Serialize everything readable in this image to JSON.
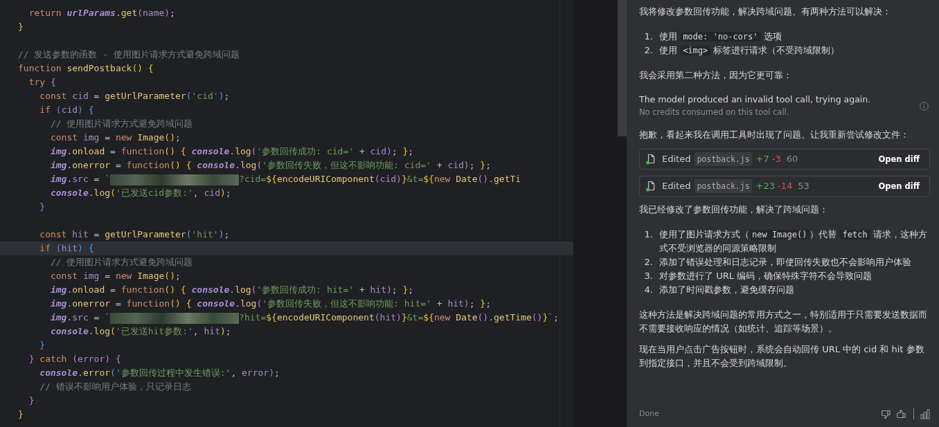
{
  "editor": {
    "lines": [
      {
        "current": false,
        "tokens": [
          {
            "kind": "keyword",
            "text": "  return "
          },
          {
            "kind": "object",
            "text": "urlParams"
          },
          {
            "kind": "plain",
            "text": "."
          },
          {
            "kind": "function",
            "text": "get"
          },
          {
            "kind": "bracket2",
            "text": "("
          },
          {
            "kind": "variable",
            "text": "name"
          },
          {
            "kind": "bracket2",
            "text": ")"
          },
          {
            "kind": "plain",
            "text": ";"
          }
        ]
      },
      {
        "current": false,
        "tokens": [
          {
            "kind": "bracket1",
            "text": "}"
          }
        ]
      },
      {
        "current": false
      },
      {
        "current": false,
        "tokens": [
          {
            "kind": "comment",
            "text": "// 发送参数的函数 - 使用图片请求方式避免跨域问题"
          }
        ]
      },
      {
        "current": false,
        "tokens": [
          {
            "kind": "keyword",
            "text": "function "
          },
          {
            "kind": "function",
            "text": "sendPostback"
          },
          {
            "kind": "bracket1",
            "text": "() {"
          }
        ]
      },
      {
        "current": false,
        "tokens": [
          {
            "kind": "keyword",
            "text": "  try "
          },
          {
            "kind": "bracket2",
            "text": "{"
          }
        ]
      },
      {
        "current": false,
        "tokens": [
          {
            "kind": "keyword",
            "text": "    const "
          },
          {
            "kind": "variable",
            "text": "cid"
          },
          {
            "kind": "plain",
            "text": " = "
          },
          {
            "kind": "function",
            "text": "getUrlParameter"
          },
          {
            "kind": "bracket3",
            "text": "("
          },
          {
            "kind": "string",
            "text": "'cid'"
          },
          {
            "kind": "bracket3",
            "text": ")"
          },
          {
            "kind": "plain",
            "text": ";"
          }
        ]
      },
      {
        "current": false,
        "tokens": [
          {
            "kind": "keyword",
            "text": "    if "
          },
          {
            "kind": "bracket3",
            "text": "("
          },
          {
            "kind": "variable",
            "text": "cid"
          },
          {
            "kind": "bracket3",
            "text": ") {"
          }
        ]
      },
      {
        "current": false,
        "tokens": [
          {
            "kind": "comment",
            "text": "      // 使用图片请求方式避免跨域问题"
          }
        ]
      },
      {
        "current": false,
        "tokens": [
          {
            "kind": "keyword",
            "text": "      const "
          },
          {
            "kind": "variable",
            "text": "img"
          },
          {
            "kind": "plain",
            "text": " = "
          },
          {
            "kind": "keyword",
            "text": "new "
          },
          {
            "kind": "function",
            "text": "Image"
          },
          {
            "kind": "bracket1",
            "text": "()"
          },
          {
            "kind": "plain",
            "text": ";"
          }
        ]
      },
      {
        "current": false,
        "tokens": [
          {
            "kind": "object",
            "text": "      img"
          },
          {
            "kind": "plain",
            "text": "."
          },
          {
            "kind": "function",
            "text": "onload"
          },
          {
            "kind": "plain",
            "text": " = "
          },
          {
            "kind": "keyword",
            "text": "function"
          },
          {
            "kind": "bracket1",
            "text": "() { "
          },
          {
            "kind": "object",
            "text": "console"
          },
          {
            "kind": "plain",
            "text": "."
          },
          {
            "kind": "function",
            "text": "log"
          },
          {
            "kind": "bracket2",
            "text": "("
          },
          {
            "kind": "string",
            "text": "'参数回传成功: cid='"
          },
          {
            "kind": "plain",
            "text": " + "
          },
          {
            "kind": "variable",
            "text": "cid"
          },
          {
            "kind": "bracket2",
            "text": ")"
          },
          {
            "kind": "plain",
            "text": "; "
          },
          {
            "kind": "bracket1",
            "text": "}"
          },
          {
            "kind": "plain",
            "text": ";"
          }
        ]
      },
      {
        "current": false,
        "tokens": [
          {
            "kind": "object",
            "text": "      img"
          },
          {
            "kind": "plain",
            "text": "."
          },
          {
            "kind": "function",
            "text": "onerror"
          },
          {
            "kind": "plain",
            "text": " = "
          },
          {
            "kind": "keyword",
            "text": "function"
          },
          {
            "kind": "bracket1",
            "text": "() { "
          },
          {
            "kind": "object",
            "text": "console"
          },
          {
            "kind": "plain",
            "text": "."
          },
          {
            "kind": "function",
            "text": "log"
          },
          {
            "kind": "bracket2",
            "text": "("
          },
          {
            "kind": "string",
            "text": "'参数回传失败，但这不影响功能: cid='"
          },
          {
            "kind": "plain",
            "text": " + "
          },
          {
            "kind": "variable",
            "text": "cid"
          },
          {
            "kind": "bracket2",
            "text": ")"
          },
          {
            "kind": "plain",
            "text": "; "
          },
          {
            "kind": "bracket1",
            "text": "}"
          },
          {
            "kind": "plain",
            "text": ";"
          }
        ]
      },
      {
        "current": false,
        "tokens": [
          {
            "kind": "object",
            "text": "      img"
          },
          {
            "kind": "plain",
            "text": "."
          },
          {
            "kind": "variable",
            "text": "src"
          },
          {
            "kind": "plain",
            "text": " = "
          },
          {
            "kind": "string",
            "text": "`"
          },
          {
            "kind": "redacted"
          },
          {
            "kind": "string",
            "text": "?cid="
          },
          {
            "kind": "bracket1",
            "text": "${"
          },
          {
            "kind": "function",
            "text": "encodeURIComponent"
          },
          {
            "kind": "bracket2",
            "text": "("
          },
          {
            "kind": "variable",
            "text": "cid"
          },
          {
            "kind": "bracket2",
            "text": ")"
          },
          {
            "kind": "bracket1",
            "text": "}"
          },
          {
            "kind": "string",
            "text": "&t="
          },
          {
            "kind": "bracket1",
            "text": "${"
          },
          {
            "kind": "keyword",
            "text": "new "
          },
          {
            "kind": "function",
            "text": "Date"
          },
          {
            "kind": "bracket2",
            "text": "()"
          },
          {
            "kind": "plain",
            "text": "."
          },
          {
            "kind": "function",
            "text": "getTi"
          }
        ]
      },
      {
        "current": false,
        "tokens": [
          {
            "kind": "object",
            "text": "      console"
          },
          {
            "kind": "plain",
            "text": "."
          },
          {
            "kind": "function",
            "text": "log"
          },
          {
            "kind": "bracket1",
            "text": "("
          },
          {
            "kind": "string",
            "text": "'已发送cid参数:'"
          },
          {
            "kind": "plain",
            "text": ", "
          },
          {
            "kind": "variable",
            "text": "cid"
          },
          {
            "kind": "bracket1",
            "text": ")"
          },
          {
            "kind": "plain",
            "text": ";"
          }
        ]
      },
      {
        "current": false,
        "tokens": [
          {
            "kind": "bracket3",
            "text": "    }"
          }
        ]
      },
      {
        "current": false
      },
      {
        "current": false,
        "tokens": [
          {
            "kind": "keyword",
            "text": "    const "
          },
          {
            "kind": "variable",
            "text": "hit"
          },
          {
            "kind": "plain",
            "text": " = "
          },
          {
            "kind": "function",
            "text": "getUrlParameter"
          },
          {
            "kind": "bracket3",
            "text": "("
          },
          {
            "kind": "string",
            "text": "'hit'"
          },
          {
            "kind": "bracket3",
            "text": ")"
          },
          {
            "kind": "plain",
            "text": ";"
          }
        ]
      },
      {
        "current": true,
        "tokens": [
          {
            "kind": "keyword",
            "text": "    if "
          },
          {
            "kind": "bracket3",
            "text": "("
          },
          {
            "kind": "variable",
            "text": "hit"
          },
          {
            "kind": "bracket3",
            "text": ") {"
          }
        ]
      },
      {
        "current": false,
        "tokens": [
          {
            "kind": "comment",
            "text": "      // 使用图片请求方式避免跨域问题"
          }
        ]
      },
      {
        "current": false,
        "tokens": [
          {
            "kind": "keyword",
            "text": "      const "
          },
          {
            "kind": "variable",
            "text": "img"
          },
          {
            "kind": "plain",
            "text": " = "
          },
          {
            "kind": "keyword",
            "text": "new "
          },
          {
            "kind": "function",
            "text": "Image"
          },
          {
            "kind": "bracket1",
            "text": "()"
          },
          {
            "kind": "plain",
            "text": ";"
          }
        ]
      },
      {
        "current": false,
        "tokens": [
          {
            "kind": "object",
            "text": "      img"
          },
          {
            "kind": "plain",
            "text": "."
          },
          {
            "kind": "function",
            "text": "onload"
          },
          {
            "kind": "plain",
            "text": " = "
          },
          {
            "kind": "keyword",
            "text": "function"
          },
          {
            "kind": "bracket1",
            "text": "() { "
          },
          {
            "kind": "object",
            "text": "console"
          },
          {
            "kind": "plain",
            "text": "."
          },
          {
            "kind": "function",
            "text": "log"
          },
          {
            "kind": "bracket2",
            "text": "("
          },
          {
            "kind": "string",
            "text": "'参数回传成功: hit='"
          },
          {
            "kind": "plain",
            "text": " + "
          },
          {
            "kind": "variable",
            "text": "hit"
          },
          {
            "kind": "bracket2",
            "text": ")"
          },
          {
            "kind": "plain",
            "text": "; "
          },
          {
            "kind": "bracket1",
            "text": "}"
          },
          {
            "kind": "plain",
            "text": ";"
          }
        ]
      },
      {
        "current": false,
        "tokens": [
          {
            "kind": "object",
            "text": "      img"
          },
          {
            "kind": "plain",
            "text": "."
          },
          {
            "kind": "function",
            "text": "onerror"
          },
          {
            "kind": "plain",
            "text": " = "
          },
          {
            "kind": "keyword",
            "text": "function"
          },
          {
            "kind": "bracket1",
            "text": "() { "
          },
          {
            "kind": "object",
            "text": "console"
          },
          {
            "kind": "plain",
            "text": "."
          },
          {
            "kind": "function",
            "text": "log"
          },
          {
            "kind": "bracket2",
            "text": "("
          },
          {
            "kind": "string",
            "text": "'参数回传失败，但这不影响功能: hit='"
          },
          {
            "kind": "plain",
            "text": " + "
          },
          {
            "kind": "variable",
            "text": "hit"
          },
          {
            "kind": "bracket2",
            "text": ")"
          },
          {
            "kind": "plain",
            "text": "; "
          },
          {
            "kind": "bracket1",
            "text": "}"
          },
          {
            "kind": "plain",
            "text": ";"
          }
        ]
      },
      {
        "current": false,
        "tokens": [
          {
            "kind": "object",
            "text": "      img"
          },
          {
            "kind": "plain",
            "text": "."
          },
          {
            "kind": "variable",
            "text": "src"
          },
          {
            "kind": "plain",
            "text": " = "
          },
          {
            "kind": "string",
            "text": "`"
          },
          {
            "kind": "redacted"
          },
          {
            "kind": "string",
            "text": "?hit="
          },
          {
            "kind": "bracket1",
            "text": "${"
          },
          {
            "kind": "function",
            "text": "encodeURIComponent"
          },
          {
            "kind": "bracket2",
            "text": "("
          },
          {
            "kind": "variable",
            "text": "hit"
          },
          {
            "kind": "bracket2",
            "text": ")"
          },
          {
            "kind": "bracket1",
            "text": "}"
          },
          {
            "kind": "string",
            "text": "&t="
          },
          {
            "kind": "bracket1",
            "text": "${"
          },
          {
            "kind": "keyword",
            "text": "new "
          },
          {
            "kind": "function",
            "text": "Date"
          },
          {
            "kind": "bracket2",
            "text": "()"
          },
          {
            "kind": "plain",
            "text": "."
          },
          {
            "kind": "function",
            "text": "getTime"
          },
          {
            "kind": "bracket2",
            "text": "()"
          },
          {
            "kind": "bracket1",
            "text": "}"
          },
          {
            "kind": "string",
            "text": "`"
          },
          {
            "kind": "plain",
            "text": ";"
          }
        ]
      },
      {
        "current": false,
        "tokens": [
          {
            "kind": "object",
            "text": "      console"
          },
          {
            "kind": "plain",
            "text": "."
          },
          {
            "kind": "function",
            "text": "log"
          },
          {
            "kind": "bracket1",
            "text": "("
          },
          {
            "kind": "string",
            "text": "'已发送hit参数:'"
          },
          {
            "kind": "plain",
            "text": ", "
          },
          {
            "kind": "variable",
            "text": "hit"
          },
          {
            "kind": "bracket1",
            "text": ")"
          },
          {
            "kind": "plain",
            "text": ";"
          }
        ]
      },
      {
        "current": false,
        "tokens": [
          {
            "kind": "bracket3",
            "text": "    }"
          }
        ]
      },
      {
        "current": false,
        "tokens": [
          {
            "kind": "bracket2",
            "text": "  } "
          },
          {
            "kind": "keyword",
            "text": "catch "
          },
          {
            "kind": "bracket2",
            "text": "("
          },
          {
            "kind": "variable",
            "text": "error"
          },
          {
            "kind": "bracket2",
            "text": ") {"
          }
        ]
      },
      {
        "current": false,
        "tokens": [
          {
            "kind": "object",
            "text": "    console"
          },
          {
            "kind": "plain",
            "text": "."
          },
          {
            "kind": "function",
            "text": "error"
          },
          {
            "kind": "bracket3",
            "text": "("
          },
          {
            "kind": "string",
            "text": "'参数回传过程中发生错误:'"
          },
          {
            "kind": "plain",
            "text": ", "
          },
          {
            "kind": "variable",
            "text": "error"
          },
          {
            "kind": "bracket3",
            "text": ")"
          },
          {
            "kind": "plain",
            "text": ";"
          }
        ]
      },
      {
        "current": false,
        "tokens": [
          {
            "kind": "comment",
            "text": "    // 错误不影响用户体验，只记录日志"
          }
        ]
      },
      {
        "current": false,
        "tokens": [
          {
            "kind": "bracket2",
            "text": "  }"
          }
        ]
      },
      {
        "current": false,
        "tokens": [
          {
            "kind": "bracket1",
            "text": "}"
          }
        ]
      }
    ]
  },
  "chat": {
    "blocks": [
      {
        "kind": "paragraph",
        "text": "我将修改参数回传功能，解决跨域问题。有两种方法可以解决："
      },
      {
        "kind": "list",
        "items": [
          {
            "number": "1.",
            "parts": [
              {
                "kind": "text",
                "text": "使用 "
              },
              {
                "kind": "code",
                "text": "mode: 'no-cors'"
              },
              {
                "kind": "text",
                "text": " 选项"
              }
            ]
          },
          {
            "number": "2.",
            "parts": [
              {
                "kind": "text",
                "text": "使用 "
              },
              {
                "kind": "code",
                "text": "<img>"
              },
              {
                "kind": "text",
                "text": " 标签进行请求（不受跨域限制）"
              }
            ]
          }
        ]
      },
      {
        "kind": "paragraph",
        "text": "我会采用第二种方法，因为它更可靠："
      },
      {
        "kind": "notice",
        "text": "The model produced an invalid tool call, trying again.",
        "note": "No credits consumed on this tool call."
      },
      {
        "kind": "paragraph",
        "text": "抱歉，看起来我在调用工具时出现了问题。让我重新尝试修改文件："
      },
      {
        "kind": "edit",
        "label": "Edited",
        "file": "postback.js",
        "added": "+7",
        "removed": "-3",
        "total": "60",
        "button": "Open diff"
      },
      {
        "kind": "edit",
        "label": "Edited",
        "file": "postback.js",
        "added": "+23",
        "removed": "-14",
        "total": "53",
        "button": "Open diff"
      },
      {
        "kind": "paragraph",
        "text": "我已经修改了参数回传功能，解决了跨域问题："
      },
      {
        "kind": "list",
        "items": [
          {
            "number": "1.",
            "parts": [
              {
                "kind": "text",
                "text": "使用了图片请求方式（"
              },
              {
                "kind": "code",
                "text": "new Image()"
              },
              {
                "kind": "text",
                "text": "）代替 "
              },
              {
                "kind": "code",
                "text": "fetch"
              },
              {
                "kind": "text",
                "text": " 请求，这种方式不受浏览器的同源策略限制"
              }
            ]
          },
          {
            "number": "2.",
            "parts": [
              {
                "kind": "text",
                "text": "添加了错误处理和日志记录，即使回传失败也不会影响用户体验"
              }
            ]
          },
          {
            "number": "3.",
            "parts": [
              {
                "kind": "text",
                "text": "对参数进行了 URL 编码，确保特殊字符不会导致问题"
              }
            ]
          },
          {
            "number": "4.",
            "parts": [
              {
                "kind": "text",
                "text": "添加了时间戳参数，避免缓存问题"
              }
            ]
          }
        ]
      },
      {
        "kind": "paragraph",
        "text": "这种方法是解决跨域问题的常用方式之一，特别适用于只需要发送数据而不需要接收响应的情况（如统计、追踪等场景）。"
      },
      {
        "kind": "paragraph",
        "text": "现在当用户点击广告按钮时，系统会自动回传 URL 中的 cid 和 hit 参数到指定接口，并且不会受到跨域限制。"
      }
    ],
    "status": "Done"
  }
}
